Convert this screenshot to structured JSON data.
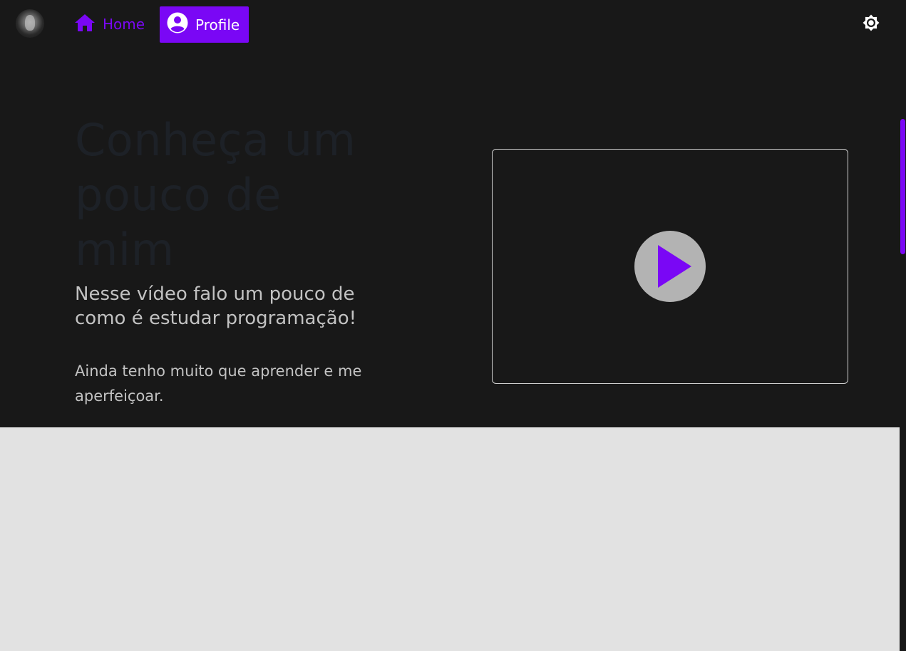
{
  "nav": {
    "home_label": "Home",
    "profile_label": "Profile"
  },
  "icons": {
    "home": "home-icon",
    "profile": "account-circle-icon",
    "theme": "brightness-icon",
    "play": "play-icon"
  },
  "hero": {
    "title": "Conheça um pouco de mim",
    "subtitle": "Nesse vídeo falo um pouco de como é estudar programação!",
    "text": "Ainda tenho muito que aprender e me aperfeiçoar."
  },
  "colors": {
    "accent": "#7a07f5",
    "hero_background": "#181818",
    "page_background": "#e2e2e2",
    "play_button": "#b3b3b3"
  }
}
